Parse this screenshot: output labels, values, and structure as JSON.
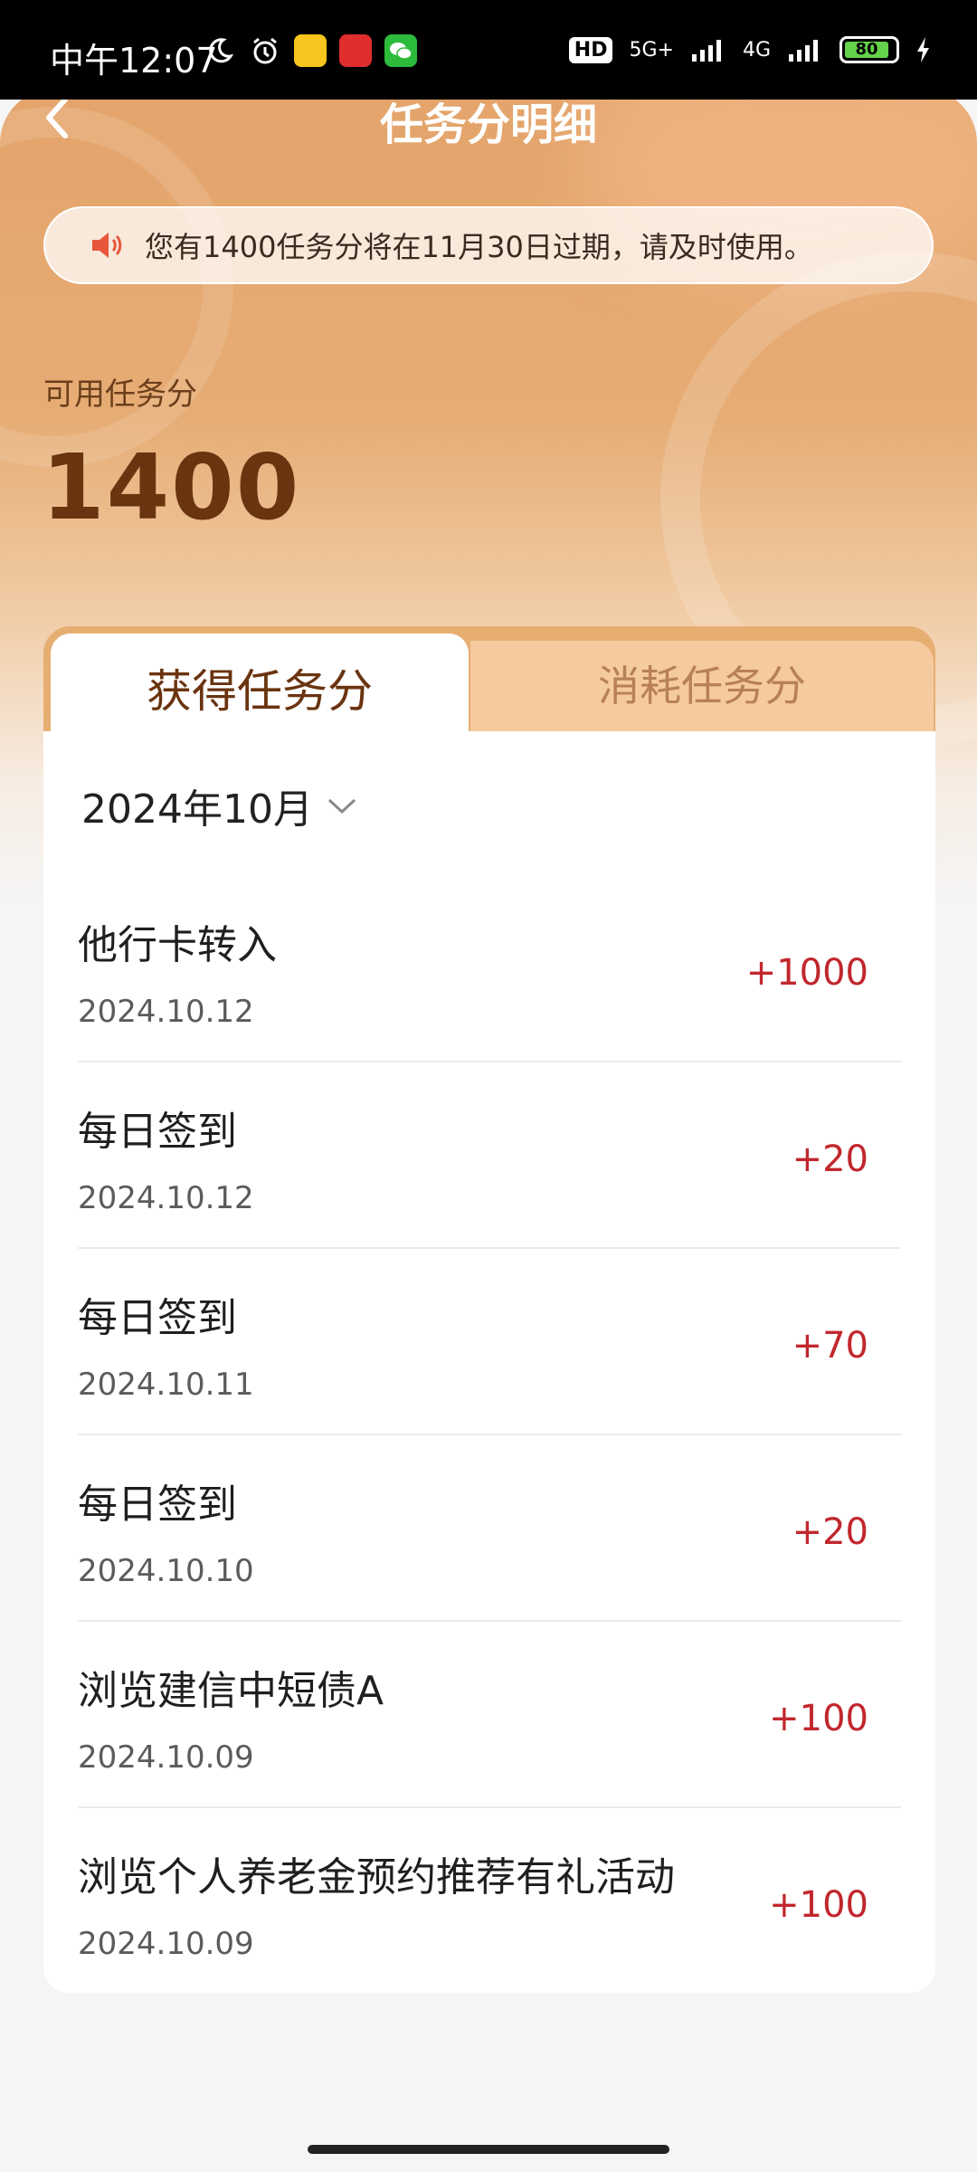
{
  "status_bar": {
    "time": "中午12:07",
    "network_badge": "HD",
    "network_5g": "5G+",
    "network_4g": "4G",
    "battery": "80"
  },
  "header": {
    "title": "任务分明细"
  },
  "notice": {
    "text": "您有1400任务分将在11月30日过期，请及时使用。"
  },
  "points": {
    "label": "可用任务分",
    "value": "1400"
  },
  "tabs": [
    {
      "label": "获得任务分",
      "active": true
    },
    {
      "label": "消耗任务分",
      "active": false
    }
  ],
  "filter": {
    "month": "2024年10月"
  },
  "records": [
    {
      "title": "他行卡转入",
      "date": "2024.10.12",
      "amount": "+1000"
    },
    {
      "title": "每日签到",
      "date": "2024.10.12",
      "amount": "+20"
    },
    {
      "title": "每日签到",
      "date": "2024.10.11",
      "amount": "+70"
    },
    {
      "title": "每日签到",
      "date": "2024.10.10",
      "amount": "+20"
    },
    {
      "title": "浏览建信中短债A",
      "date": "2024.10.09",
      "amount": "+100"
    },
    {
      "title": "浏览个人养老金预约推荐有礼活动",
      "date": "2024.10.09",
      "amount": "+100"
    }
  ],
  "colors": {
    "accent": "#e7ae72",
    "amount": "#c1272d",
    "brown_text": "#6a3410"
  }
}
